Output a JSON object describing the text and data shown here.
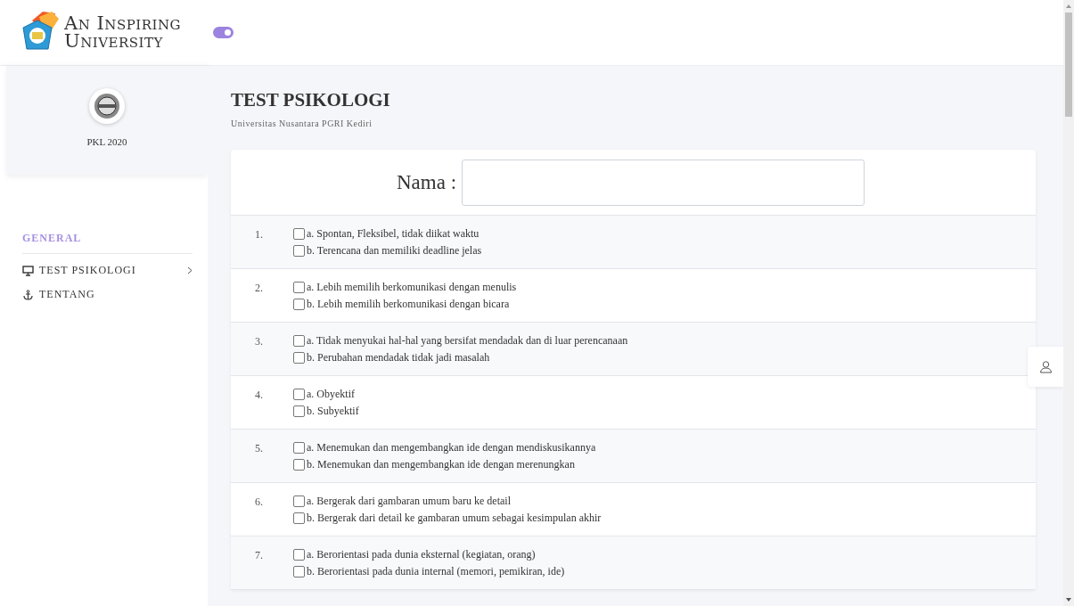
{
  "logo": {
    "line1": "An Inspiring",
    "line2": "University"
  },
  "sidebar_toggle": {
    "on": true
  },
  "profile": {
    "name": "PKL 2020"
  },
  "nav": {
    "heading": "GENERAL",
    "items": [
      {
        "label": "TEST PSIKOLOGI",
        "kind": "monitor",
        "has_children": true
      },
      {
        "label": "TENTANG",
        "kind": "anchor",
        "has_children": false
      }
    ]
  },
  "page": {
    "title": "TEST PSIKOLOGI",
    "subtitle": "Universitas Nusantara PGRI Kediri"
  },
  "name_field": {
    "label": "Nama :"
  },
  "questions": [
    {
      "number": "1.",
      "options": [
        {
          "label": "a. Spontan, Fleksibel, tidak diikat waktu",
          "checked": false
        },
        {
          "label": "b. Terencana dan memiliki deadline jelas",
          "checked": false
        }
      ]
    },
    {
      "number": "2.",
      "options": [
        {
          "label": "a. Lebih memilih berkomunikasi dengan menulis",
          "checked": false
        },
        {
          "label": "b. Lebih memilih berkomunikasi dengan bicara",
          "checked": false
        }
      ]
    },
    {
      "number": "3.",
      "options": [
        {
          "label": "a. Tidak menyukai hal-hal yang bersifat mendadak dan di luar perencanaan",
          "checked": false
        },
        {
          "label": "b. Perubahan mendadak tidak jadi masalah",
          "checked": false
        }
      ]
    },
    {
      "number": "4.",
      "options": [
        {
          "label": "a. Obyektif",
          "checked": false
        },
        {
          "label": "b. Subyektif",
          "checked": false
        }
      ]
    },
    {
      "number": "5.",
      "options": [
        {
          "label": "a. Menemukan dan mengembangkan ide dengan mendiskusikannya",
          "checked": false
        },
        {
          "label": "b. Menemukan dan mengembangkan ide dengan merenungkan",
          "checked": false
        }
      ]
    },
    {
      "number": "6.",
      "options": [
        {
          "label": "a. Bergerak dari gambaran umum baru ke detail",
          "checked": false
        },
        {
          "label": "b. Bergerak dari detail ke gambaran umum sebagai kesimpulan akhir",
          "checked": false
        }
      ]
    },
    {
      "number": "7.",
      "options": [
        {
          "label": "a. Berorientasi pada dunia eksternal (kegiatan, orang)",
          "checked": false
        },
        {
          "label": "b. Berorientasi pada dunia internal (memori, pemikiran, ide)",
          "checked": false
        }
      ]
    }
  ]
}
